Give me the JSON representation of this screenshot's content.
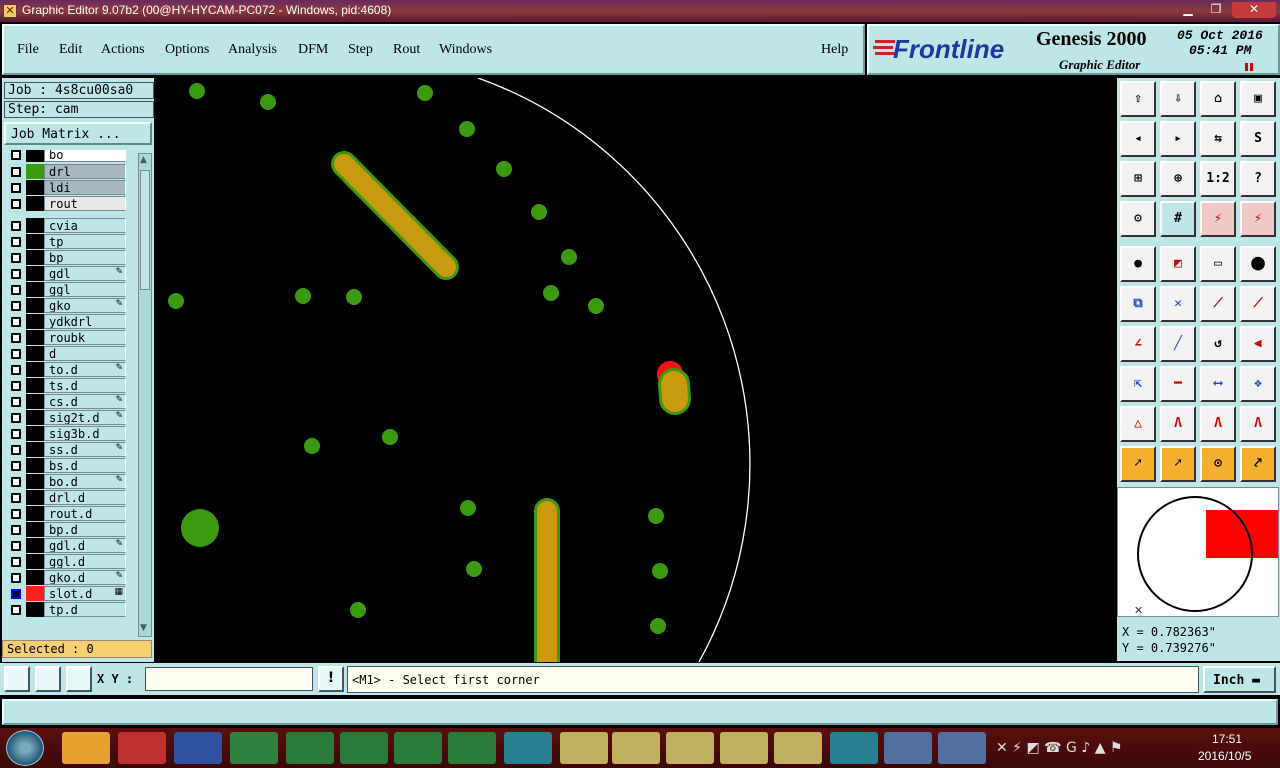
{
  "window": {
    "title": "Graphic Editor 9.07b2 (00@HY-HYCAM-PC072 - Windows, pid:4608)"
  },
  "menu": [
    "File",
    "Edit",
    "Actions",
    "Options",
    "Analysis",
    "DFM",
    "Step",
    "Rout",
    "Windows"
  ],
  "help": "Help",
  "brand": {
    "logo": "Frontline",
    "product": "Genesis 2000",
    "subtitle": "Graphic Editor",
    "date": "05 Oct 2016",
    "time": "05:41 PM"
  },
  "job": {
    "job": "Job : 4s8cu00sa0",
    "step": "Step: cam",
    "matrix": "Job Matrix ..."
  },
  "layers": [
    {
      "name": "bo",
      "color": "#000000",
      "mark": ""
    },
    {
      "name": "drl",
      "color": "#3c9a10",
      "mark": ""
    },
    {
      "name": "ldi",
      "color": "#000000",
      "mark": ""
    },
    {
      "name": "rout",
      "color": "#000000",
      "mark": ""
    },
    {
      "name": "cvia",
      "color": "#000000",
      "mark": ""
    },
    {
      "name": "tp",
      "color": "#000000",
      "mark": ""
    },
    {
      "name": "bp",
      "color": "#000000",
      "mark": ""
    },
    {
      "name": "gdl",
      "color": "#000000",
      "mark": "✎"
    },
    {
      "name": "ggl",
      "color": "#000000",
      "mark": ""
    },
    {
      "name": "gko",
      "color": "#000000",
      "mark": "✎"
    },
    {
      "name": "ydkdrl",
      "color": "#000000",
      "mark": ""
    },
    {
      "name": "roubk",
      "color": "#000000",
      "mark": ""
    },
    {
      "name": "d",
      "color": "#000000",
      "mark": ""
    },
    {
      "name": "to.d",
      "color": "#000000",
      "mark": "✎"
    },
    {
      "name": "ts.d",
      "color": "#000000",
      "mark": ""
    },
    {
      "name": "cs.d",
      "color": "#000000",
      "mark": "✎"
    },
    {
      "name": "sig2t.d",
      "color": "#000000",
      "mark": "✎"
    },
    {
      "name": "sig3b.d",
      "color": "#000000",
      "mark": ""
    },
    {
      "name": "ss.d",
      "color": "#000000",
      "mark": "✎"
    },
    {
      "name": "bs.d",
      "color": "#000000",
      "mark": ""
    },
    {
      "name": "bo.d",
      "color": "#000000",
      "mark": "✎"
    },
    {
      "name": "drl.d",
      "color": "#000000",
      "mark": ""
    },
    {
      "name": "rout.d",
      "color": "#000000",
      "mark": ""
    },
    {
      "name": "bp.d",
      "color": "#000000",
      "mark": ""
    },
    {
      "name": "gdl.d",
      "color": "#000000",
      "mark": "✎"
    },
    {
      "name": "ggl.d",
      "color": "#000000",
      "mark": ""
    },
    {
      "name": "gko.d",
      "color": "#000000",
      "mark": "✎"
    },
    {
      "name": "slot.d",
      "color": "#ff2020",
      "mark": "▦"
    },
    {
      "name": "tp.d",
      "color": "#000000",
      "mark": ""
    }
  ],
  "selected": "Selected : 0",
  "coords": {
    "x": "X = 0.782363\"",
    "y": "Y = 0.739276\""
  },
  "cmd": {
    "xy_label": "X Y :",
    "xy_value": "",
    "prompt": "<M1> - Select first corner",
    "units": "Inch"
  },
  "taskbar": {
    "time": "17:51",
    "date": "2016/10/5"
  },
  "colors": {
    "panel": "#bfe6e6",
    "pad": "#3c9a10",
    "slot": "#c89a10",
    "highlight": "#ff1010"
  }
}
